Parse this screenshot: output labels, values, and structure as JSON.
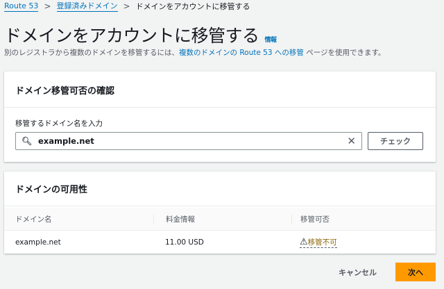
{
  "breadcrumb": {
    "items": [
      "Route 53",
      "登録済みドメイン"
    ],
    "current": "ドメインをアカウントに移管する"
  },
  "page": {
    "title": "ドメインをアカウントに移管する",
    "info": "情報",
    "desc_before": "別のレジストラから複数のドメインを移管するには、",
    "desc_link": "複数のドメインの Route 53 への移管",
    "desc_after": " ページを使用できます。"
  },
  "check_panel": {
    "header": "ドメイン移管可否の確認",
    "label": "移管するドメイン名を入力",
    "input_value": "example.net",
    "check_button": "チェック"
  },
  "availability_panel": {
    "header": "ドメインの可用性",
    "columns": [
      "ドメイン名",
      "料金情報",
      "移管可否"
    ],
    "rows": [
      {
        "domain": "example.net",
        "price": "11.00 USD",
        "status": "移管不可"
      }
    ]
  },
  "footer": {
    "cancel": "キャンセル",
    "next": "次へ"
  },
  "colors": {
    "accent": "#ff9900",
    "link": "#0073bb",
    "warning": "#8d6605"
  }
}
